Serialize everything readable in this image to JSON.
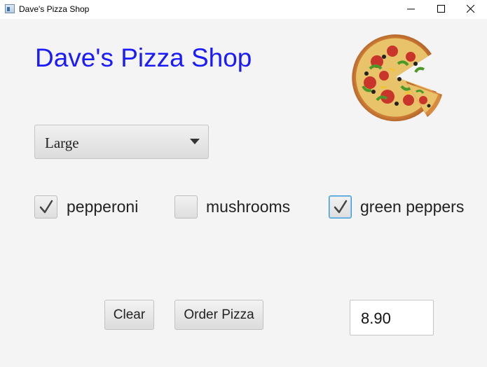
{
  "window": {
    "title": "Dave's Pizza Shop",
    "icon": "app-window-icon"
  },
  "header": {
    "shop_title": "Dave's Pizza Shop",
    "image": "pizza-image",
    "title_color": "#1a1aff"
  },
  "size_select": {
    "selected": "Large"
  },
  "toppings": [
    {
      "label": "pepperoni",
      "checked": true
    },
    {
      "label": "mushrooms",
      "checked": false
    },
    {
      "label": "green peppers",
      "checked": true,
      "focused": true
    }
  ],
  "buttons": {
    "clear_label": "Clear",
    "order_label": "Order Pizza"
  },
  "price": {
    "value": "8.90"
  }
}
